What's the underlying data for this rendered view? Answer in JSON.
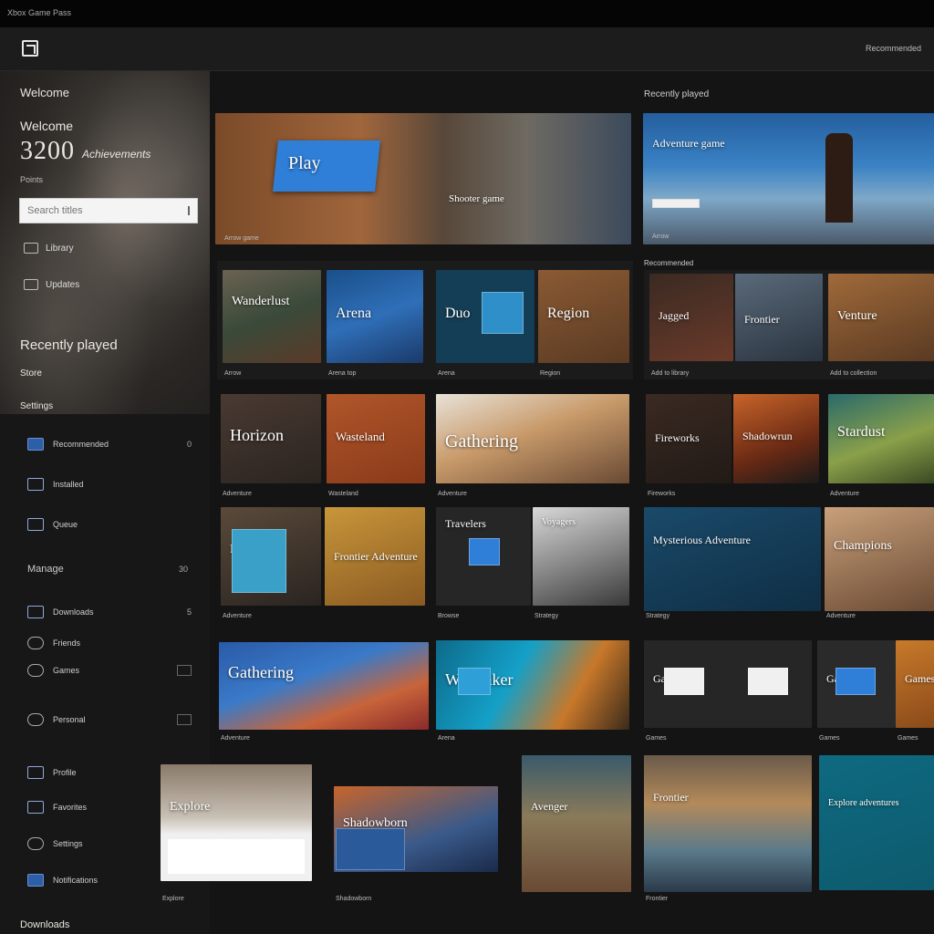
{
  "titlebar": {
    "title": "Xbox Game Pass"
  },
  "appbar": {
    "account": "Recommended"
  },
  "sidebar": {
    "heading": "Welcome",
    "subheading": "Welcome",
    "number": "3200",
    "number_caption": "Achievements",
    "small": "Points",
    "search_placeholder": "Search titles",
    "hero_items": [
      "Library",
      "Updates"
    ],
    "big": "Recently played",
    "small2": "Store",
    "small3": "Settings",
    "nav": [
      {
        "label": "Recommended",
        "count": "0"
      },
      {
        "label": "Installed"
      },
      {
        "label": "Queue"
      }
    ],
    "section": {
      "label": "Manage",
      "count": "30"
    },
    "nav2": [
      {
        "label": "Downloads",
        "count": "5"
      },
      {
        "label": "Friends"
      },
      {
        "label": "Games"
      },
      {
        "label": "Personal"
      },
      {
        "label": "Profile"
      },
      {
        "label": "Favorites"
      },
      {
        "label": "Settings"
      },
      {
        "label": "Notifications"
      }
    ],
    "bottom": "Downloads"
  },
  "main": {
    "header_left": "Welcome",
    "header_right": "Recently played",
    "featured": [
      {
        "label": "Play",
        "caption": "Arrow game"
      },
      {
        "label": "Shooter game",
        "caption": ""
      },
      {
        "label": "Adventure game",
        "caption": "Arrow"
      }
    ],
    "row_label": "Recommended",
    "row1": [
      {
        "label": "Wanderlust",
        "caption": "Arrow"
      },
      {
        "label": "Arena",
        "caption": "Arena top"
      },
      {
        "label": "Duo",
        "caption": "Arena"
      },
      {
        "label": "Region",
        "caption": "Region"
      },
      {
        "label": "Jagged",
        "caption": "Add to library"
      },
      {
        "label": "Frontier",
        "caption": ""
      },
      {
        "label": "Venture",
        "caption": "Add to collection"
      }
    ],
    "row2": [
      {
        "label": "Horizon",
        "caption": "Adventure"
      },
      {
        "label": "Wasteland",
        "caption": "Wasteland"
      },
      {
        "label": "Gathering",
        "caption": "Adventure"
      },
      {
        "label": "Fireworks",
        "caption": "Fireworks"
      },
      {
        "label": "Shadowrun",
        "caption": ""
      },
      {
        "label": "Stardust",
        "caption": "Adventure"
      }
    ],
    "row3": [
      {
        "label": "Frontier",
        "caption": "Adventure"
      },
      {
        "label": "Frontier Adventure",
        "caption": ""
      },
      {
        "label": "Travelers",
        "caption": "Browse"
      },
      {
        "label": "Voyagers",
        "caption": "Strategy"
      },
      {
        "label": "Mysterious Adventure",
        "caption": "Strategy"
      },
      {
        "label": "Champions",
        "caption": "Adventure"
      }
    ],
    "row4": [
      {
        "label": "Gathering",
        "caption": "Adventure"
      },
      {
        "label": "Warmaker",
        "caption": "Arena"
      },
      {
        "label": "Games",
        "caption": "Games"
      },
      {
        "label": "Games",
        "caption": "Games"
      },
      {
        "label": "Games",
        "caption": "Games"
      }
    ],
    "row5": [
      {
        "label": "Explore",
        "caption": "Explore"
      },
      {
        "label": "Shadowborn",
        "caption": "Shadowborn"
      },
      {
        "label": "Avenger",
        "caption": ""
      },
      {
        "label": "Frontier",
        "caption": "Frontier"
      },
      {
        "label": "Explore adventures",
        "caption": ""
      }
    ]
  },
  "colors": {
    "accent": "#2f7fd8",
    "background": "#141414",
    "panel": "#1c1c1c"
  }
}
